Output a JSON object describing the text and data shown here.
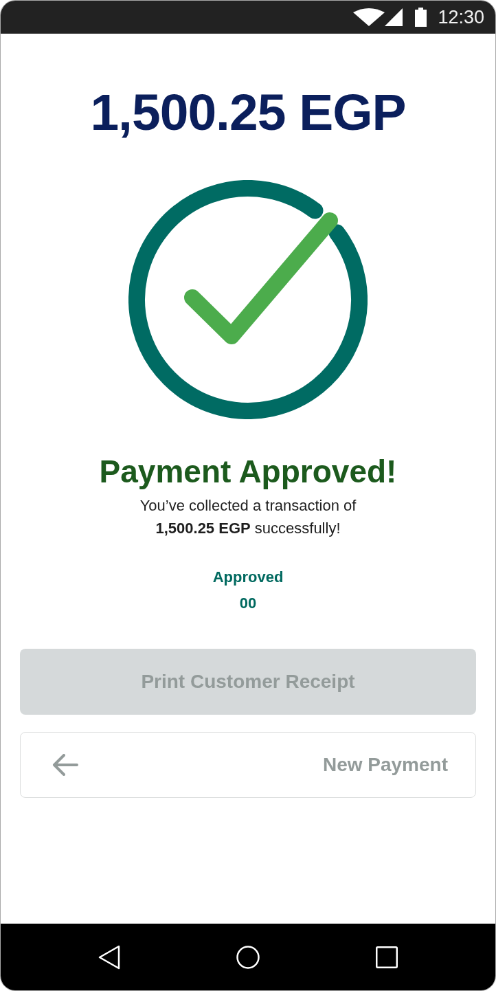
{
  "status_bar": {
    "time": "12:30"
  },
  "amount": "1,500.25 EGP",
  "title": "Payment Approved!",
  "message": "You’ve collected a transaction of **1,500.25 EGP** successfully!",
  "response": {
    "label": "Approved",
    "code": "00"
  },
  "buttons": [
    {
      "kind": "filled",
      "label": "Print Customer Receipt",
      "disabled": true
    },
    {
      "kind": "outline",
      "label": "New Payment",
      "disabled": true
    }
  ]
}
